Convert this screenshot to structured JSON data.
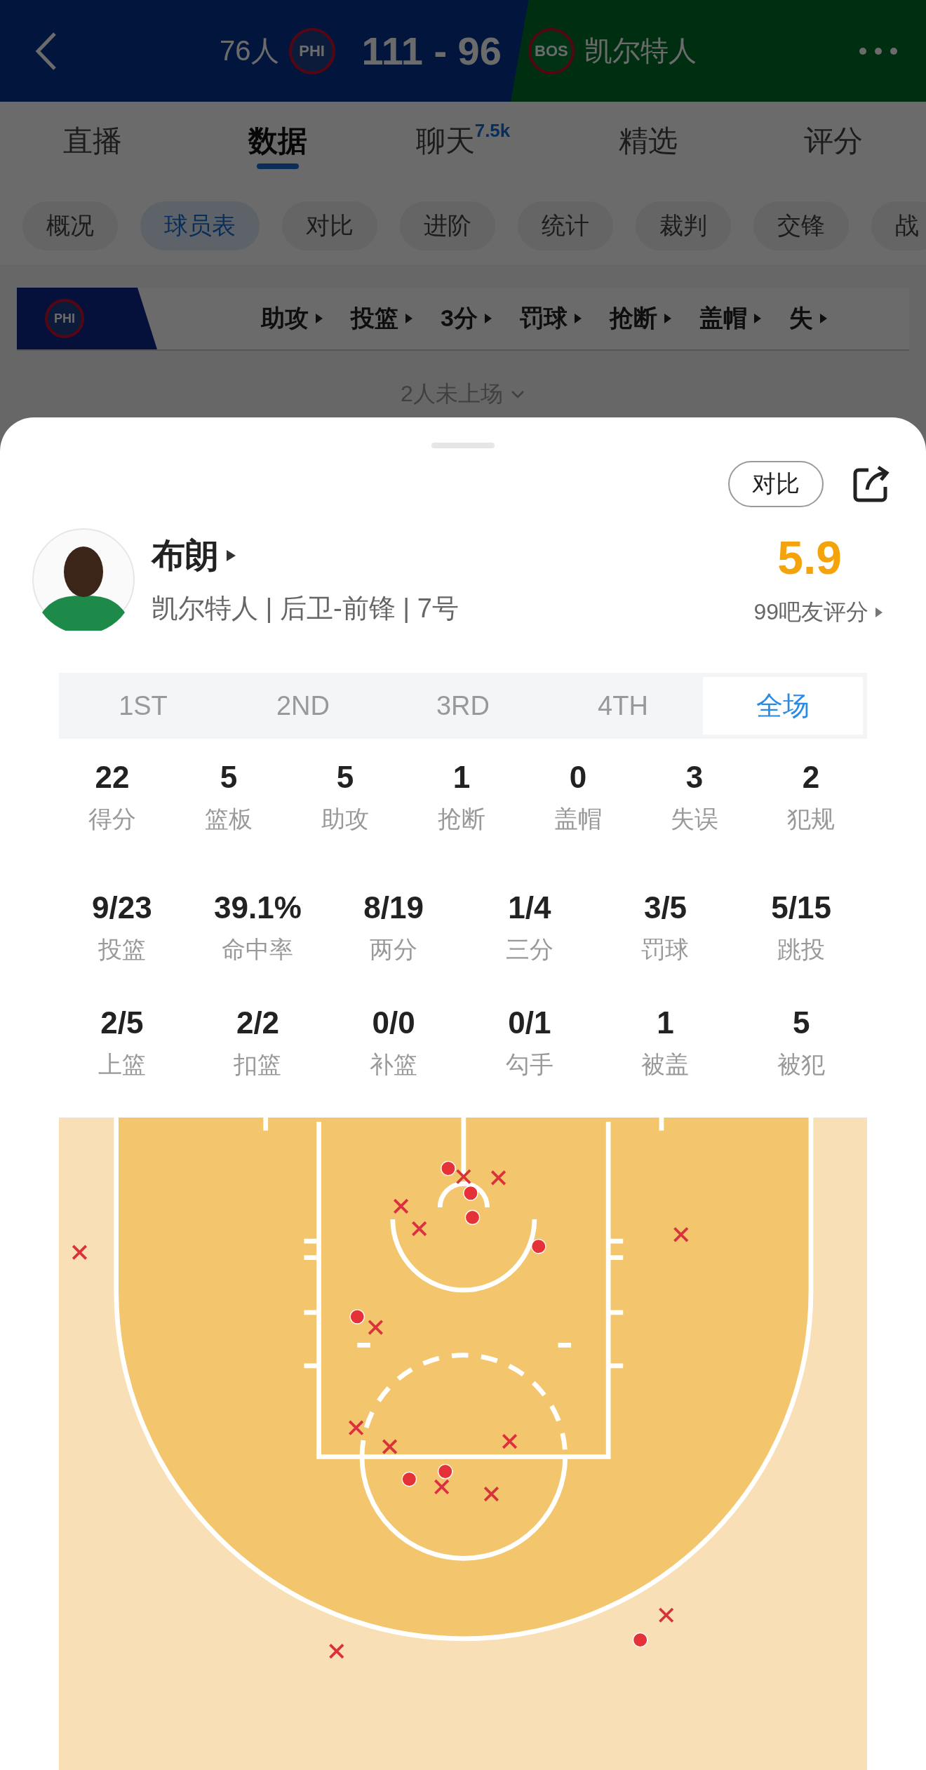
{
  "header": {
    "home": {
      "name": "76人",
      "abbr": "PHI"
    },
    "score": "111 - 96",
    "away": {
      "name": "凯尔特人",
      "abbr": "BOS"
    }
  },
  "tabs": [
    {
      "label": "直播",
      "selected": false
    },
    {
      "label": "数据",
      "selected": true
    },
    {
      "label": "聊天",
      "badge": "7.5k",
      "selected": false
    },
    {
      "label": "精选",
      "selected": false
    },
    {
      "label": "评分",
      "selected": false
    }
  ],
  "chips": [
    {
      "label": "概况",
      "selected": false
    },
    {
      "label": "球员表",
      "selected": true
    },
    {
      "label": "对比",
      "selected": false
    },
    {
      "label": "进阶",
      "selected": false
    },
    {
      "label": "统计",
      "selected": false
    },
    {
      "label": "裁判",
      "selected": false
    },
    {
      "label": "交锋",
      "selected": false
    },
    {
      "label": "战",
      "selected": false
    }
  ],
  "table_header": {
    "team_abbr": "PHI",
    "columns": [
      "助攻",
      "投篮",
      "3分",
      "罚球",
      "抢断",
      "盖帽",
      "失"
    ]
  },
  "bench_note": "2人未上场",
  "sheet": {
    "compare_button": "对比",
    "player": {
      "name": "布朗",
      "info": "凯尔特人 | 后卫-前锋 | 7号"
    },
    "rating": "5.9",
    "rating_note": "99吧友评分",
    "period_tabs": [
      {
        "label": "1ST",
        "selected": false
      },
      {
        "label": "2ND",
        "selected": false
      },
      {
        "label": "3RD",
        "selected": false
      },
      {
        "label": "4TH",
        "selected": false
      },
      {
        "label": "全场",
        "selected": true
      }
    ],
    "stat_rows": [
      [
        {
          "value": "22",
          "label": "得分"
        },
        {
          "value": "5",
          "label": "篮板"
        },
        {
          "value": "5",
          "label": "助攻"
        },
        {
          "value": "1",
          "label": "抢断"
        },
        {
          "value": "0",
          "label": "盖帽"
        },
        {
          "value": "3",
          "label": "失误"
        },
        {
          "value": "2",
          "label": "犯规"
        }
      ],
      [
        {
          "value": "9/23",
          "label": "投篮"
        },
        {
          "value": "39.1%",
          "label": "命中率"
        },
        {
          "value": "8/19",
          "label": "两分"
        },
        {
          "value": "1/4",
          "label": "三分"
        },
        {
          "value": "3/5",
          "label": "罚球"
        },
        {
          "value": "5/15",
          "label": "跳投"
        }
      ],
      [
        {
          "value": "2/5",
          "label": "上篮"
        },
        {
          "value": "2/2",
          "label": "扣篮"
        },
        {
          "value": "0/0",
          "label": "补篮"
        },
        {
          "value": "0/1",
          "label": "勾手"
        },
        {
          "value": "1",
          "label": "被盖"
        },
        {
          "value": "5",
          "label": "被犯"
        }
      ]
    ],
    "shot_chart": {
      "shots": [
        {
          "made": false
        },
        {
          "made": false
        },
        {
          "made": false
        },
        {
          "made": false
        },
        {
          "made": false
        },
        {
          "made": false
        },
        {
          "made": false
        },
        {
          "made": false
        },
        {
          "made": false
        },
        {
          "made": false
        },
        {
          "made": false
        },
        {
          "made": false
        },
        {
          "made": false
        },
        {
          "made": false
        },
        {
          "made": true
        },
        {
          "made": true
        },
        {
          "made": true
        },
        {
          "made": true
        },
        {
          "made": true
        },
        {
          "made": true
        },
        {
          "made": true
        },
        {
          "made": true
        }
      ]
    }
  }
}
